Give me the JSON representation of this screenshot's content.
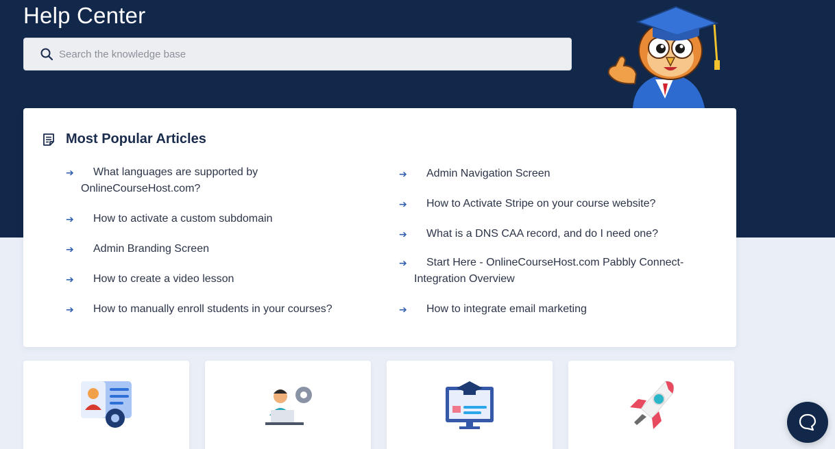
{
  "header": {
    "title": "Help Center",
    "search_placeholder": "Search the knowledge base"
  },
  "popular": {
    "heading": "Most Popular Articles",
    "left_articles": [
      "What languages are supported by OnlineCourseHost.com?",
      "How to activate a custom subdomain",
      "Admin Branding Screen",
      "How to create a video lesson",
      "How to manually enroll students in your courses?"
    ],
    "right_articles": [
      "Admin Navigation Screen",
      "How to Activate Stripe on your course website?",
      "What is a DNS CAA record, and do I need one?",
      "Start Here - OnlineCourseHost.com Pabbly Connect- Integration Overview",
      "How to integrate email marketing"
    ]
  },
  "categories": [
    {
      "icon": "profile-settings-icon"
    },
    {
      "icon": "admin-laptop-icon"
    },
    {
      "icon": "online-course-monitor-icon"
    },
    {
      "icon": "rocket-icon"
    }
  ],
  "colors": {
    "hero_bg": "#12284a",
    "page_bg": "#eaeff7",
    "link_arrow": "#2f5fae"
  }
}
